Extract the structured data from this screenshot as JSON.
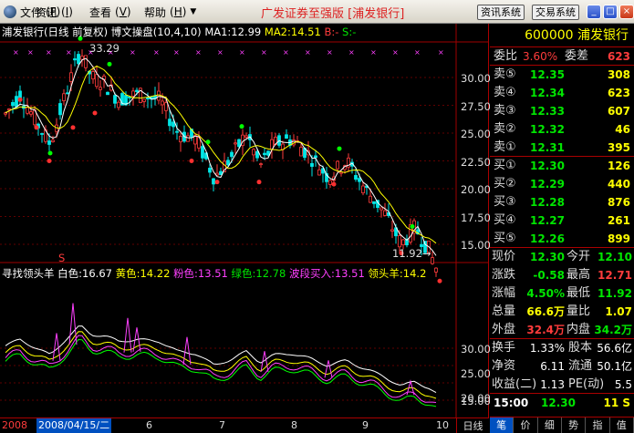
{
  "menu": {
    "items": [
      {
        "label": "文件",
        "key": "F"
      },
      {
        "label": "资讯",
        "key": "I"
      },
      {
        "label": "查看",
        "key": "V"
      },
      {
        "label": "帮助",
        "key": "H"
      }
    ]
  },
  "app_title": "广发证券至强版 [浦发银行]",
  "sys_buttons": {
    "info": "资讯系统",
    "trade": "交易系统"
  },
  "chart_info": {
    "name": "浦发银行(日线 前复权)",
    "indicator": "博文操盘(10,4,10)",
    "ma1": "MA1:12.99",
    "ma2": "MA2:14.51",
    "b_label": "B:-",
    "s_label": "S:-"
  },
  "annotations": {
    "high": "33.29",
    "low": "11.92→",
    "s_marker": "S"
  },
  "price_axis": [
    "30.00",
    "27.50",
    "25.00",
    "22.50",
    "20.00",
    "17.50",
    "15.00"
  ],
  "lower_axis": [
    "30.00",
    "25.00",
    "20.00",
    "15.00"
  ],
  "lower_info": {
    "name": "寻找领头羊",
    "white": "白色:16.67",
    "yellow": "黄色:14.22",
    "pink": "粉色:13.51",
    "green": "绿色:12.78",
    "wave": "波段买入:13.51",
    "leader": "领头羊:14.2"
  },
  "date_axis": {
    "prefix": "2008",
    "cursor": "2008/04/15/二",
    "ticks": [
      "6",
      "7",
      "8",
      "9",
      "10"
    ],
    "tab": "日线"
  },
  "quote": {
    "code": "600000",
    "name": "浦发银行",
    "wei_bi_label": "委比",
    "wei_bi": "3.60%",
    "wei_cha_label": "委差",
    "wei_cha": "623",
    "sells": [
      {
        "label": "卖⑤",
        "price": "12.35",
        "vol": "308"
      },
      {
        "label": "卖④",
        "price": "12.34",
        "vol": "623"
      },
      {
        "label": "卖③",
        "price": "12.33",
        "vol": "607"
      },
      {
        "label": "卖②",
        "price": "12.32",
        "vol": "46"
      },
      {
        "label": "卖①",
        "price": "12.31",
        "vol": "395"
      }
    ],
    "buys": [
      {
        "label": "买①",
        "price": "12.30",
        "vol": "126"
      },
      {
        "label": "买②",
        "price": "12.29",
        "vol": "440"
      },
      {
        "label": "买③",
        "price": "12.28",
        "vol": "876"
      },
      {
        "label": "买④",
        "price": "12.27",
        "vol": "261"
      },
      {
        "label": "买⑤",
        "price": "12.26",
        "vol": "899"
      }
    ],
    "stats": [
      {
        "l1": "现价",
        "v1": "12.30",
        "l2": "今开",
        "v2": "12.10"
      },
      {
        "l1": "涨跌",
        "v1": "-0.58",
        "l2": "最高",
        "v2": "12.71"
      },
      {
        "l1": "涨幅",
        "v1": "4.50%",
        "l2": "最低",
        "v2": "11.92"
      },
      {
        "l1": "总量",
        "v1": "66.6万",
        "l2": "量比",
        "v2": "1.07"
      },
      {
        "l1": "外盘",
        "v1": "32.4万",
        "l2": "内盘",
        "v2": "34.2万"
      }
    ],
    "fin": [
      {
        "l1": "换手",
        "v1": "1.33%",
        "l2": "股本",
        "v2": "56.6亿"
      },
      {
        "l1": "净资",
        "v1": "6.11",
        "l2": "流通",
        "v2": "50.1亿"
      },
      {
        "l1": "收益(二)",
        "v1": "1.13",
        "l2": "PE(动)",
        "v2": "5.5"
      }
    ],
    "tick": {
      "time": "15:00",
      "price": "12.30",
      "vol": "11 S"
    }
  },
  "panel_tabs": [
    "笔",
    "价",
    "细",
    "势",
    "指",
    "值"
  ],
  "colors": {
    "up": "#ff3c3c",
    "down": "#00e6e6",
    "ma1": "#ffffff",
    "ma2": "#ffff00",
    "grid": "#a00000"
  }
}
